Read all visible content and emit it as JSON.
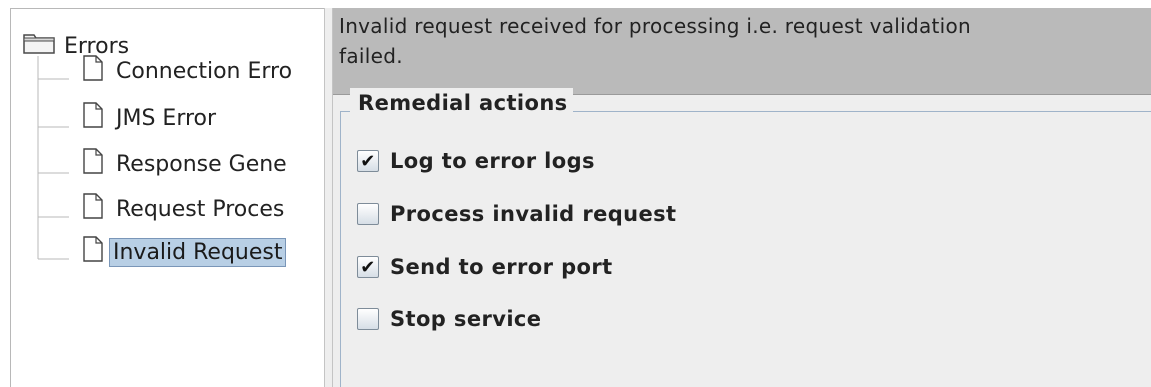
{
  "tree": {
    "root_label": "Errors",
    "items": [
      {
        "label": "Connection Erro",
        "selected": false
      },
      {
        "label": "JMS Error",
        "selected": false
      },
      {
        "label": "Response Gene",
        "selected": false
      },
      {
        "label": "Request Proces",
        "selected": false
      },
      {
        "label": "Invalid Request",
        "selected": true
      }
    ]
  },
  "details": {
    "description_line1": "Invalid request received for processing i.e. request validation",
    "description_line2": "failed.",
    "group_title": "Remedial actions",
    "actions": [
      {
        "label": "Log to error logs",
        "checked": true
      },
      {
        "label": "Process invalid request",
        "checked": false
      },
      {
        "label": "Send to error port",
        "checked": true
      },
      {
        "label": "Stop service",
        "checked": false
      }
    ],
    "check_mark": "✔"
  }
}
